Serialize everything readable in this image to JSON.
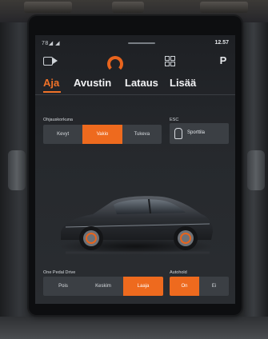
{
  "status": {
    "left": "78◢ ◢",
    "time": "12.57"
  },
  "topbar": {
    "park_label": "P"
  },
  "tabs": [
    {
      "label": "Aja",
      "active": true
    },
    {
      "label": "Avustin",
      "active": false
    },
    {
      "label": "Lataus",
      "active": false
    },
    {
      "label": "Lisää",
      "active": false
    }
  ],
  "steering": {
    "label": "Ohjauskorkuna",
    "options": [
      "Kevyt",
      "Vakio",
      "Tukeva"
    ],
    "selected": "Vakio"
  },
  "esc": {
    "label": "ESC",
    "button": "Sporttila"
  },
  "one_pedal": {
    "label": "One Pedal Drive",
    "options": [
      "Pois",
      "Keskim",
      "Laaja"
    ],
    "selected": "Laaja"
  },
  "autohold": {
    "label": "Autohold",
    "options": [
      "On",
      "Ei"
    ],
    "selected": "On"
  },
  "colors": {
    "accent": "#ee6a1e",
    "screen_bg": "#26292d",
    "button_bg": "#3b3f44"
  },
  "icons": [
    "camera-icon",
    "speedometer-icon",
    "grid-icon",
    "car-icon",
    "esc-icon"
  ]
}
